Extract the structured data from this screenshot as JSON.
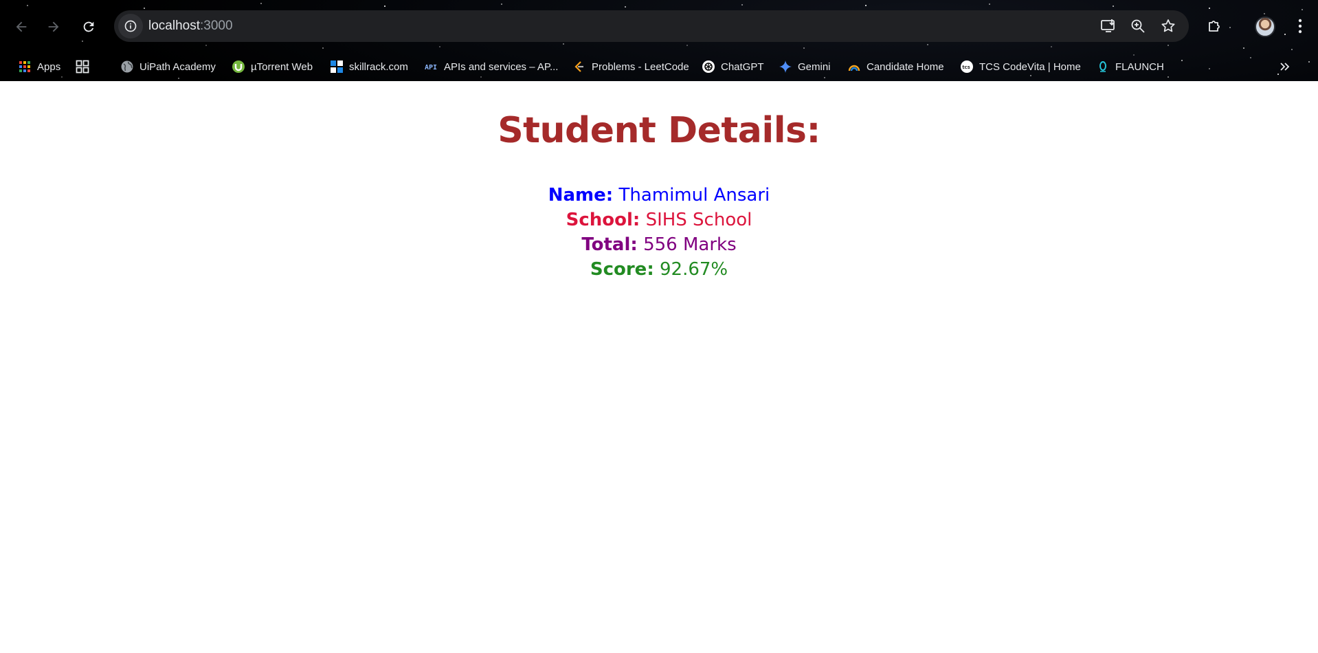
{
  "browser": {
    "url_host": "localhost",
    "url_port": ":3000",
    "bookmarks": [
      {
        "label": "Apps",
        "icon": "apps-grid-icon"
      },
      {
        "label": "",
        "icon": "tab-groups-icon"
      },
      {
        "label": "UiPath Academy",
        "icon": "globe-icon"
      },
      {
        "label": "µTorrent Web",
        "icon": "utorrent-icon"
      },
      {
        "label": "skillrack.com",
        "icon": "skillrack-icon"
      },
      {
        "label": "APIs and services – AP...",
        "icon": "api-icon"
      },
      {
        "label": "Problems - LeetCode",
        "icon": "leetcode-icon"
      },
      {
        "label": "ChatGPT",
        "icon": "chatgpt-icon"
      },
      {
        "label": "Gemini",
        "icon": "gemini-icon"
      },
      {
        "label": "Candidate Home",
        "icon": "candidate-icon"
      },
      {
        "label": "TCS CodeVita | Home",
        "icon": "tcs-icon"
      },
      {
        "label": "FLAUNCH",
        "icon": "flaunch-icon"
      }
    ]
  },
  "page": {
    "title": "Student Details:",
    "rows": [
      {
        "label": "Name:",
        "value": "Thamimul Ansari",
        "color": "#0000ff"
      },
      {
        "label": "School:",
        "value": "SIHS School",
        "color": "#dc143c"
      },
      {
        "label": "Total:",
        "value": "556 Marks",
        "color": "#800080"
      },
      {
        "label": "Score:",
        "value": "92.67%",
        "color": "#228b22"
      }
    ]
  }
}
